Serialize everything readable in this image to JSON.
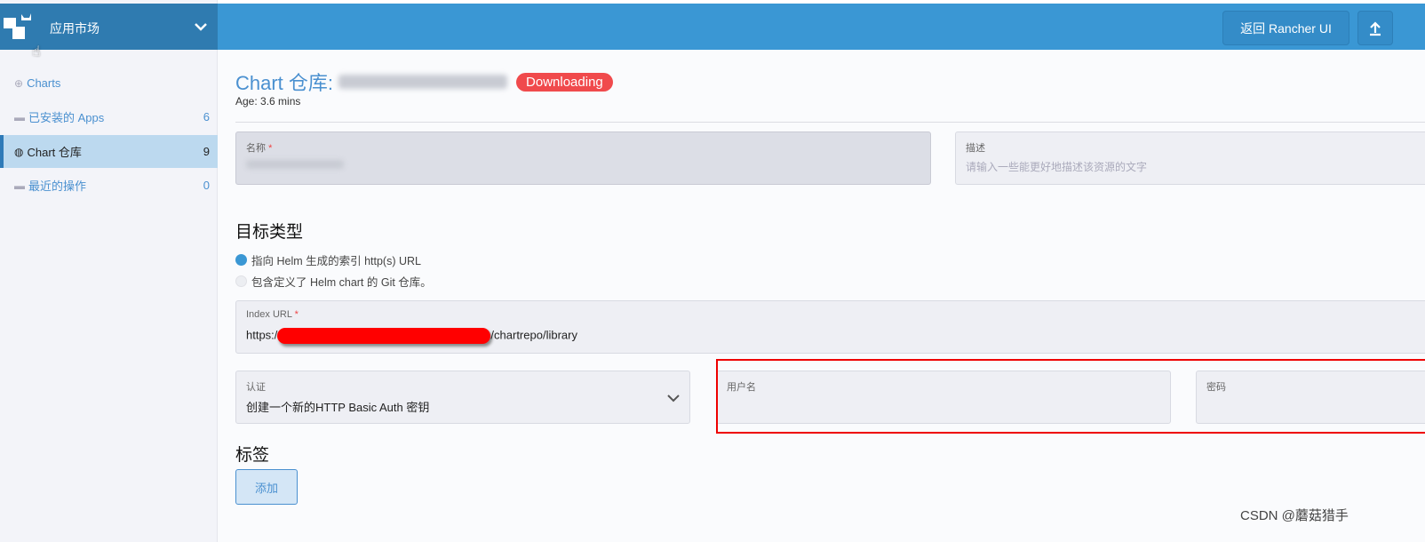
{
  "sidebar": {
    "title": "应用市场",
    "items": [
      {
        "label": "Charts",
        "icon": "plus-circle-icon",
        "count": ""
      },
      {
        "label": "已安装的 Apps",
        "icon": "folder-icon",
        "count": "6"
      },
      {
        "label": "Chart 仓库",
        "icon": "globe-icon",
        "count": "9",
        "active": true
      },
      {
        "label": "最近的操作",
        "icon": "folder-icon",
        "count": "0"
      }
    ]
  },
  "header": {
    "back_label": "返回 Rancher UI",
    "upload_icon": "upload-icon"
  },
  "page": {
    "title": "Chart 仓库:",
    "status": "Downloading",
    "age_label": "Age:",
    "age_value": "3.6 mins"
  },
  "form": {
    "name_label": "名称",
    "desc_label": "描述",
    "desc_placeholder": "请输入一些能更好地描述该资源的文字",
    "target_heading": "目标类型",
    "target_options": [
      {
        "label": "指向 Helm 生成的索引 http(s) URL",
        "selected": true
      },
      {
        "label": "包含定义了 Helm chart 的 Git 仓库。",
        "selected": false
      }
    ],
    "index_url_label": "Index URL",
    "index_url_prefix": "https:/",
    "index_url_suffix": "/chartrepo/library",
    "auth_label": "认证",
    "auth_value": "创建一个新的HTTP Basic Auth 密钥",
    "username_label": "用户名",
    "password_label": "密码",
    "labels_heading": "标签",
    "add_label": "添加"
  },
  "colors": {
    "accent": "#3a97d4",
    "status": "#f04a4c",
    "highlight": "#e00000"
  },
  "watermark": "CSDN @蘑菇猎手"
}
